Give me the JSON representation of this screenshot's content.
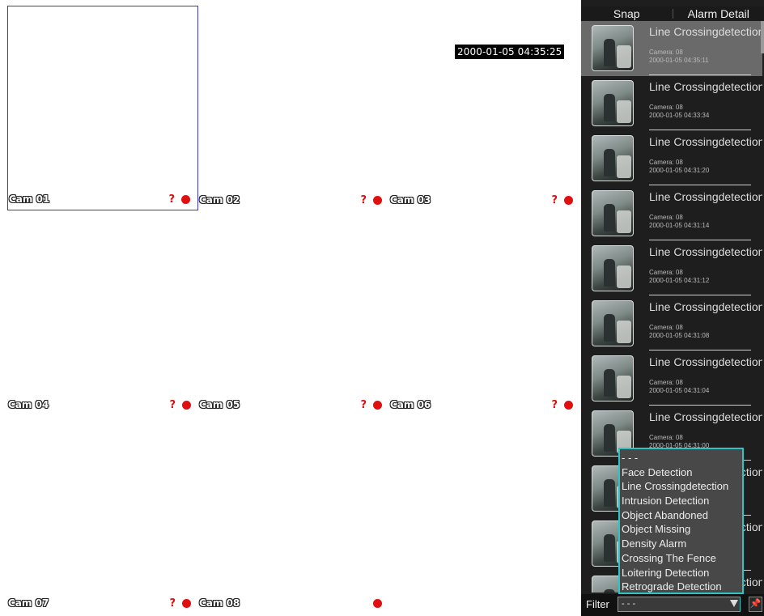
{
  "datetime": "2000-01-05 04:35:25",
  "cameras": [
    {
      "label": "Cam 01",
      "unknown_mark": "?",
      "recording": true
    },
    {
      "label": "Cam 02",
      "unknown_mark": "?",
      "recording": true
    },
    {
      "label": "Cam 03",
      "unknown_mark": "?",
      "recording": true
    },
    {
      "label": "Cam 04",
      "unknown_mark": "?",
      "recording": true
    },
    {
      "label": "Cam 05",
      "unknown_mark": "?",
      "recording": true
    },
    {
      "label": "Cam 06",
      "unknown_mark": "?",
      "recording": true
    },
    {
      "label": "Cam 07",
      "unknown_mark": "?",
      "recording": true
    },
    {
      "label": "Cam 08",
      "unknown_mark": "",
      "recording": true
    }
  ],
  "panel": {
    "tabs": [
      "Snap",
      "Alarm Detail"
    ],
    "alarms": [
      {
        "title": "Line Crossingdetection",
        "camera": "Camera: 08",
        "time": "2000-01-05 04:35:11"
      },
      {
        "title": "Line Crossingdetection",
        "camera": "Camera: 08",
        "time": "2000-01-05 04:33:34"
      },
      {
        "title": "Line Crossingdetection",
        "camera": "Camera: 08",
        "time": "2000-01-05 04:31:20"
      },
      {
        "title": "Line Crossingdetection",
        "camera": "Camera: 08",
        "time": "2000-01-05 04:31:14"
      },
      {
        "title": "Line Crossingdetection",
        "camera": "Camera: 08",
        "time": "2000-01-05 04:31:12"
      },
      {
        "title": "Line Crossingdetection",
        "camera": "Camera: 08",
        "time": "2000-01-05 04:31:08"
      },
      {
        "title": "Line Crossingdetection",
        "camera": "Camera: 08",
        "time": "2000-01-05 04:31:04"
      },
      {
        "title": "Line Crossingdetection",
        "camera": "Camera: 08",
        "time": "2000-01-05 04:31:00"
      },
      {
        "title": "Line Crossingdetection",
        "camera": "",
        "time": ""
      },
      {
        "title": "Line Crossingdetection",
        "camera": "",
        "time": ""
      },
      {
        "title": "Line Crossingdetection",
        "camera": "",
        "time": ""
      }
    ],
    "filter": {
      "label": "Filter",
      "value": "- - -",
      "options": [
        "- - -",
        "Face Detection",
        "Line Crossingdetection",
        "Intrusion Detection",
        "Object Abandoned",
        "Object Missing",
        "Density Alarm",
        "Crossing The Fence",
        "Loitering Detection",
        "Retrograde Detection"
      ]
    }
  },
  "colors": {
    "accent": "#2ec4c4",
    "record": "#e01010",
    "selection": "#3a3ab8"
  }
}
